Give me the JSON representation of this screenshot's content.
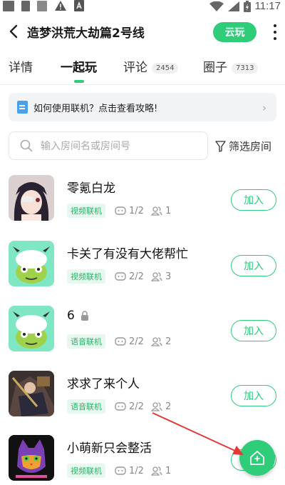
{
  "status_bar": {
    "time": "11:17"
  },
  "header": {
    "title": "造梦洪荒大劫篇2号线",
    "cloud_label": "云玩"
  },
  "tabs": [
    {
      "label": "详情"
    },
    {
      "label": "一起玩"
    },
    {
      "label": "评论",
      "badge": "2454"
    },
    {
      "label": "圈子",
      "badge": "7313"
    }
  ],
  "tip": {
    "text": "如何使用联机？点击查看攻略!"
  },
  "search": {
    "placeholder": "输入房间名或房间号",
    "filter_label": "筛选房间"
  },
  "rooms": [
    {
      "name": "零氪白龙",
      "tag": "视频联机",
      "players": "1/2",
      "online": "1",
      "locked": false,
      "join": "加入"
    },
    {
      "name": "卡关了有没有大佬帮忙",
      "tag": "视频联机",
      "players": "2/2",
      "online": "3",
      "locked": false,
      "join": "加入"
    },
    {
      "name": "6",
      "tag": "语音联机",
      "players": "2/2",
      "online": "2",
      "locked": true,
      "join": "加入"
    },
    {
      "name": "求求了来个人",
      "tag": "语音联机",
      "players": "2/2",
      "online": "2",
      "locked": false,
      "join": "加入"
    },
    {
      "name": "小萌新只会整活",
      "tag": "视频联机",
      "players": "1/2",
      "online": "1",
      "locked": false,
      "join": "加入"
    }
  ],
  "colors": {
    "accent": "#2fcc7a",
    "annotation_arrow": "#e53935"
  }
}
